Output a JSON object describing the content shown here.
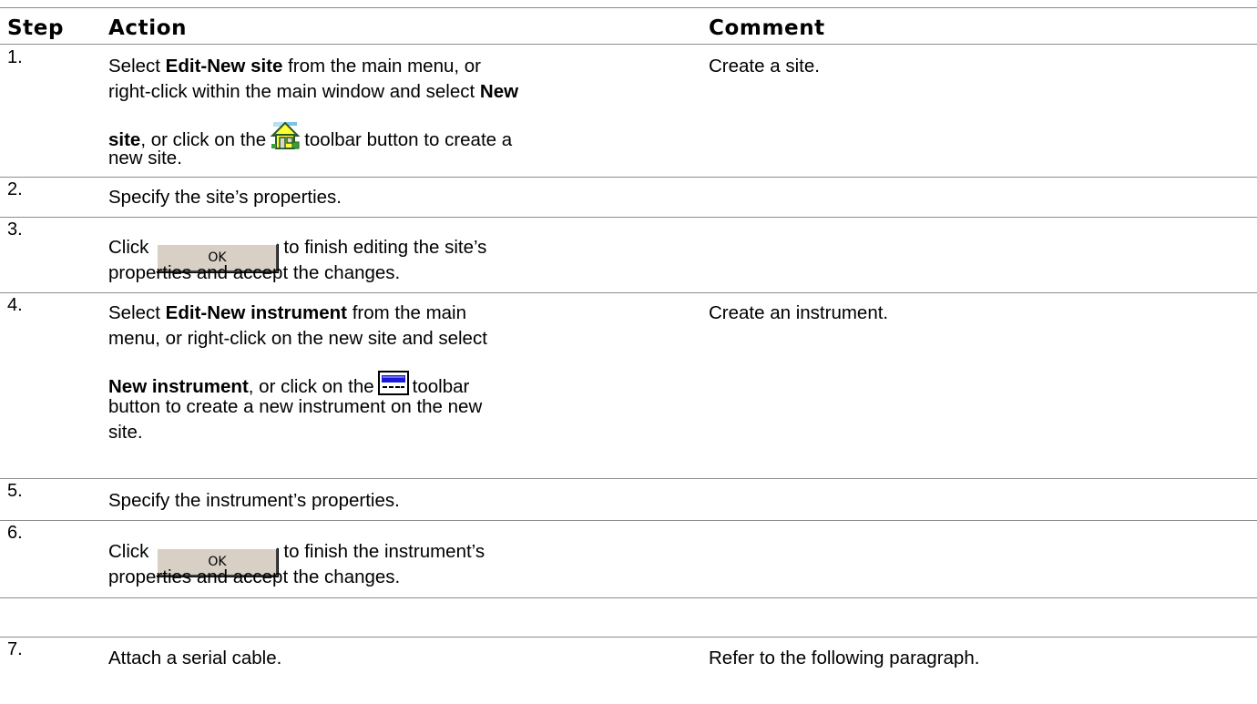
{
  "headers": {
    "step": "Step",
    "action": "Action",
    "comment": "Comment"
  },
  "rows": [
    {
      "num": "1.",
      "action": {
        "l1_a": "Select ",
        "l1_b": "Edit-New site",
        "l1_c": " from the main menu, or",
        "l2_a": "right-click within the main window and select ",
        "l2_b": "New",
        "l3_a": "site",
        "l3_b": ", or click on the",
        "l3_c": "toolbar button to create a",
        "l4": "new site."
      },
      "comment": "Create a site.",
      "icon": "new-site-house-icon"
    },
    {
      "num": "2.",
      "action": "Specify the site’s properties.",
      "comment": ""
    },
    {
      "num": "3.",
      "action": {
        "l1_a": "Click",
        "button": "OK",
        "l1_b": "to finish editing the site’s",
        "l2": "properties and accept the changes."
      },
      "comment": ""
    },
    {
      "num": "4.",
      "action": {
        "l1_a": "Select ",
        "l1_b": "Edit-New instrument",
        "l1_c": " from the main",
        "l2": "menu, or right-click on the new site and select",
        "l3_a": "New instrument",
        "l3_b": ", or click on the",
        "l3_c": "toolbar",
        "l4": "button to create a new instrument on the new",
        "l5": "site."
      },
      "comment": "Create an instrument.",
      "icon": "new-instrument-icon"
    },
    {
      "num": "5.",
      "action": "Specify the instrument’s properties.",
      "comment": ""
    },
    {
      "num": "6.",
      "action": {
        "l1_a": "Click",
        "button": "OK",
        "l1_b": "to finish the instrument’s",
        "l2": "properties and accept the changes."
      },
      "comment": ""
    },
    {
      "num": "7.",
      "action": "Attach a serial cable.",
      "comment": "Refer to the following paragraph."
    }
  ]
}
